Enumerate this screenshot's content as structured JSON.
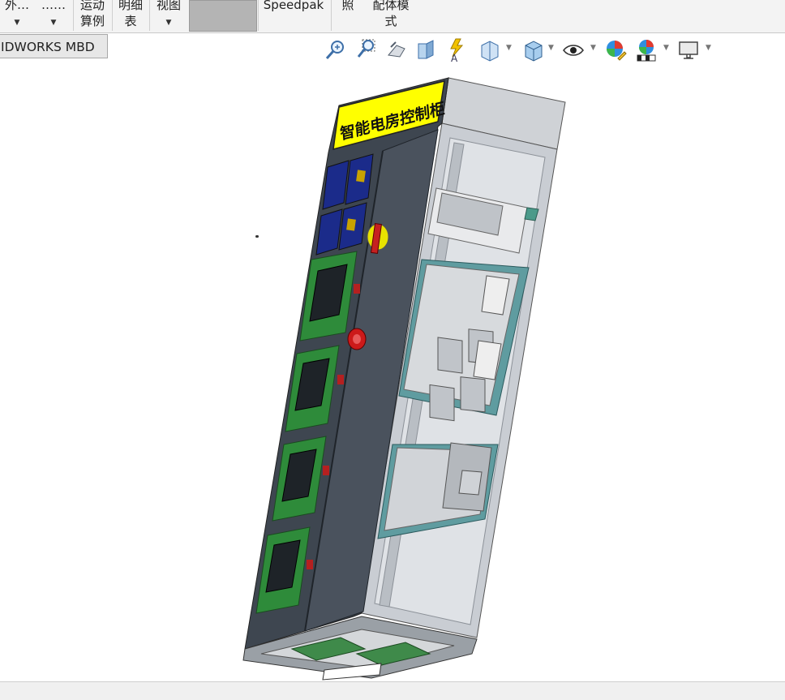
{
  "ribbon": {
    "partial_left_1": "外…",
    "partial_left_2": "……",
    "motion_study_l1": "运动",
    "motion_study_l2": "算例",
    "bom_l1": "明细",
    "bom_l2": "表",
    "view_l1": "视图",
    "speedpak": "Speedpak",
    "photo": "照",
    "assembly_mode_l1": "配体模",
    "assembly_mode_l2": "式"
  },
  "tabs": {
    "mbd_tab": "IDWORKS MBD"
  },
  "heads_up_toolbar": [
    {
      "icon": "zoom-to-fit-icon"
    },
    {
      "icon": "zoom-to-area-icon"
    },
    {
      "icon": "previous-view-icon"
    },
    {
      "icon": "section-view-icon"
    },
    {
      "icon": "dynamic-annotation-icon"
    },
    {
      "icon": "view-orientation-icon"
    },
    {
      "icon": "display-style-icon"
    },
    {
      "icon": "hide-show-items-icon"
    },
    {
      "icon": "edit-appearance-icon"
    },
    {
      "icon": "apply-scene-icon"
    },
    {
      "icon": "view-settings-icon"
    }
  ],
  "model": {
    "cabinet_label": "智能电房控制柜",
    "label_color": "#ffff00",
    "body_color": "#3e4650",
    "side_color": "#c9cdd3"
  }
}
